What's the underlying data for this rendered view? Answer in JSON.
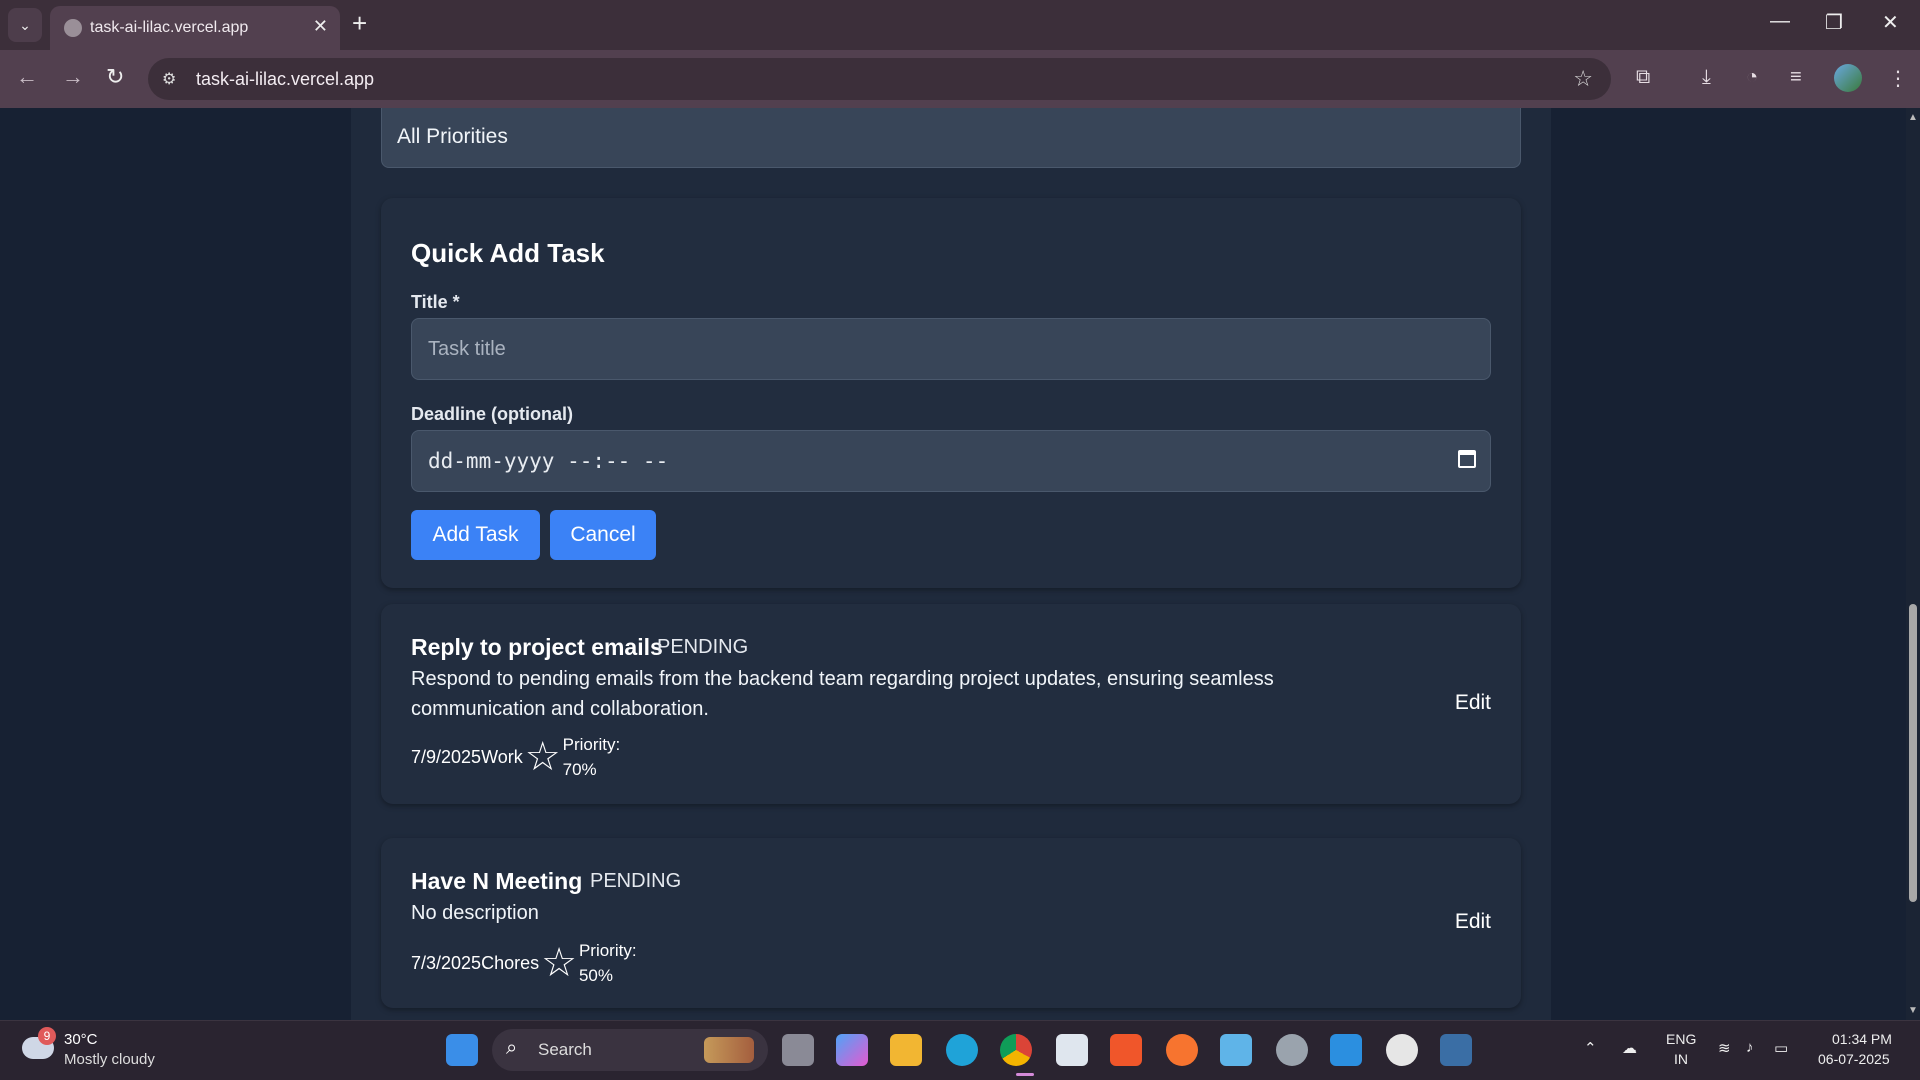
{
  "browser": {
    "tab_title": "task-ai-lilac.vercel.app",
    "url": "task-ai-lilac.vercel.app"
  },
  "filter": {
    "priority_value": "All Priorities"
  },
  "quick_add": {
    "heading": "Quick Add Task",
    "title_label": "Title *",
    "title_placeholder": "Task title",
    "deadline_label": "Deadline (optional)",
    "deadline_placeholder": "dd-mm-yyyy --:-- --",
    "add_label": "Add Task",
    "cancel_label": "Cancel"
  },
  "tasks": [
    {
      "title": "Reply to project emails",
      "status": "PENDING",
      "description": "Respond to pending emails from the backend team regarding project updates, ensuring seamless communication and collaboration.",
      "date_category": "7/9/2025Work",
      "priority_label": "Priority:",
      "priority_value": "70%",
      "edit_label": "Edit"
    },
    {
      "title": "Have N Meeting",
      "status": "PENDING",
      "description": "No description",
      "date_category": "7/3/2025Chores",
      "priority_label": "Priority:",
      "priority_value": "50%",
      "edit_label": "Edit"
    }
  ],
  "taskbar": {
    "weather_temp": "30°C",
    "weather_desc": "Mostly cloudy",
    "weather_badge": "9",
    "search_label": "Search",
    "lang_top": "ENG",
    "lang_bottom": "IN",
    "time": "01:34 PM",
    "date": "06-07-2025"
  },
  "colors": {
    "accent": "#3b82f6",
    "page_bg": "#1f2a3c",
    "card_bg": "#222d3f"
  }
}
